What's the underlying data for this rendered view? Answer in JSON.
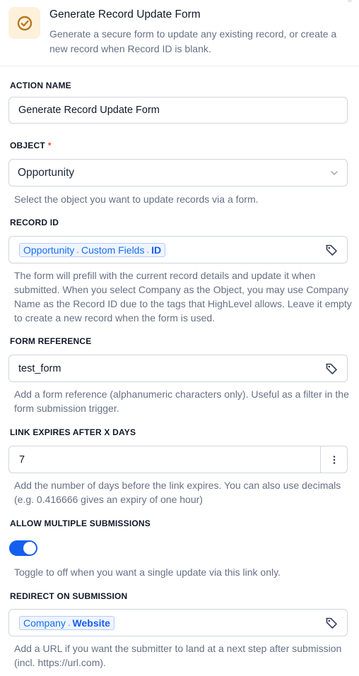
{
  "header": {
    "title": "Generate Record Update Form",
    "description": "Generate a secure form to update any existing record, or create a new record when Record ID is blank.",
    "icon": "check-circle-icon",
    "icon_color": "#b7791f",
    "icon_bg": "#fdf1dc"
  },
  "action_name": {
    "label": "ACTION NAME",
    "value": "Generate Record Update Form"
  },
  "object": {
    "label": "OBJECT",
    "required_mark": "*",
    "selected": "Opportunity",
    "help": "Select the object you want to update records via a form."
  },
  "record_id": {
    "label": "RECORD ID",
    "chip_parts": [
      "Opportunity",
      "Custom Fields",
      "ID"
    ],
    "separator": ".",
    "help": "The form will prefill with the current record details and update it when submitted. When you select Company as the Object, you may use Company Name as the Record ID due to the tags that HighLevel allows. Leave it empty to create a new record when the form is used."
  },
  "form_reference": {
    "label": "FORM REFERENCE",
    "value": "test_form",
    "help": "Add a form reference (alphanumeric characters only). Useful as a filter in the form submission trigger."
  },
  "link_expires": {
    "label": "LINK EXPIRES AFTER X DAYS",
    "value": "7",
    "help": "Add the number of days before the link expires. You can also use decimals (e.g. 0.416666 gives an expiry of one hour)"
  },
  "allow_multiple": {
    "label": "ALLOW MULTIPLE SUBMISSIONS",
    "enabled": true,
    "help": "Toggle to off when you want a single update via this link only."
  },
  "redirect": {
    "label": "REDIRECT ON SUBMISSION",
    "chip_parts": [
      "Company",
      "Website"
    ],
    "separator": ".",
    "help": "Add a URL if you want the submitter to land at a next step after submission (incl. https://url.com)."
  },
  "colors": {
    "accent": "#155eef",
    "chip_bg": "#eff4ff",
    "chip_text": "#1570ef",
    "required": "#f04438"
  }
}
